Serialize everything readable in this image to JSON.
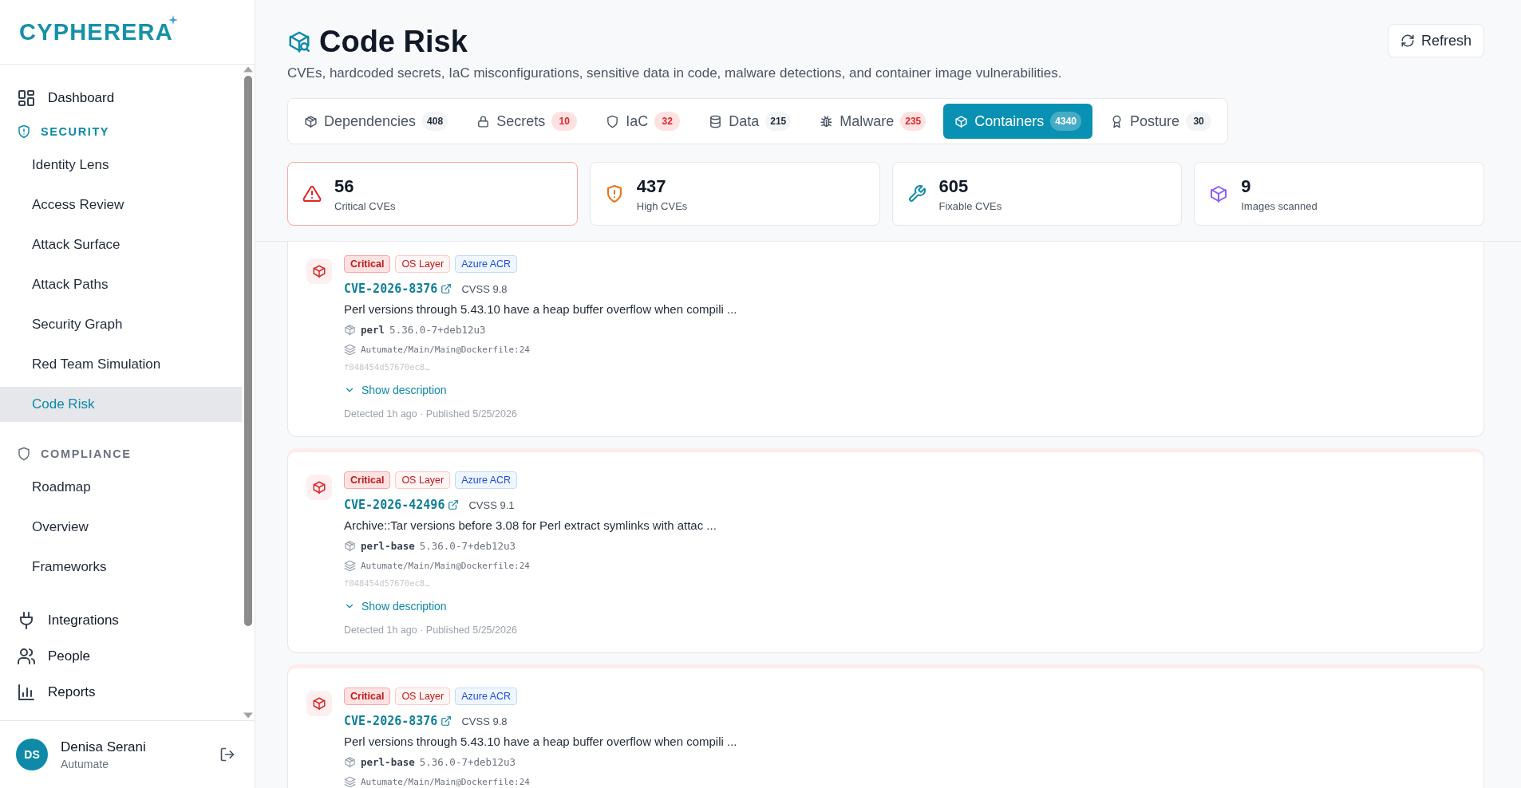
{
  "sidebar": {
    "logo": "CYPHERERA",
    "nav": [
      {
        "kind": "link",
        "label": "Dashboard",
        "selected": false
      },
      {
        "kind": "section",
        "label": "SECURITY",
        "children": [
          {
            "label": "Identity Lens",
            "selected": false
          },
          {
            "label": "Access Review",
            "selected": false
          },
          {
            "label": "Attack Surface",
            "selected": false
          },
          {
            "label": "Attack Paths",
            "selected": false
          },
          {
            "label": "Security Graph",
            "selected": false
          },
          {
            "label": "Red Team Simulation",
            "selected": false
          },
          {
            "label": "Code Risk",
            "selected": true
          }
        ]
      },
      {
        "kind": "section",
        "label": "COMPLIANCE",
        "children": [
          {
            "label": "Roadmap",
            "selected": false
          },
          {
            "label": "Overview",
            "selected": false
          },
          {
            "label": "Frameworks",
            "selected": false
          }
        ]
      },
      {
        "kind": "link",
        "label": "Integrations",
        "selected": false
      },
      {
        "kind": "link",
        "label": "People",
        "selected": false
      },
      {
        "kind": "link",
        "label": "Reports",
        "selected": false
      }
    ],
    "user": {
      "initials": "DS",
      "name": "Denisa Serani",
      "org": "Autumate"
    }
  },
  "header": {
    "title": "Code Risk",
    "subtitle": "CVEs, hardcoded secrets, IaC misconfigurations, sensitive data in code, malware detections, and container image vulnerabilities.",
    "refresh": "Refresh"
  },
  "tabs": [
    {
      "label": "Dependencies",
      "count": "408",
      "alert": false,
      "selected": false
    },
    {
      "label": "Secrets",
      "count": "10",
      "alert": true,
      "selected": false
    },
    {
      "label": "IaC",
      "count": "32",
      "alert": true,
      "selected": false
    },
    {
      "label": "Data",
      "count": "215",
      "alert": false,
      "selected": false
    },
    {
      "label": "Malware",
      "count": "235",
      "alert": true,
      "selected": false
    },
    {
      "label": "Containers",
      "count": "4340",
      "alert": false,
      "selected": true
    },
    {
      "label": "Posture",
      "count": "30",
      "alert": false,
      "selected": false
    }
  ],
  "stats": [
    {
      "kind": "critical",
      "value": "56",
      "label": "Critical CVEs"
    },
    {
      "kind": "high",
      "value": "437",
      "label": "High CVEs"
    },
    {
      "kind": "fixable",
      "value": "605",
      "label": "Fixable CVEs"
    },
    {
      "kind": "images",
      "value": "9",
      "label": "Images scanned"
    }
  ],
  "findings": [
    {
      "tags": [
        {
          "kind": "severity",
          "text": "Critical"
        },
        {
          "kind": "layer",
          "text": "OS Layer"
        },
        {
          "kind": "registry",
          "text": "Azure ACR"
        }
      ],
      "cve": "CVE-2026-8376",
      "cvss": "CVSS 9.8",
      "description": "Perl versions through 5.43.10 have a heap buffer overflow when compili ...",
      "package": "perl",
      "version": "5.36.0-7+deb12u3",
      "path": "Autumate/Main/Main@Dockerfile:24",
      "hash": "f048454d57670ec8…",
      "toggle": "Show description",
      "expanded": false,
      "meta": "Detected 1h ago · Published 5/25/2026"
    },
    {
      "tags": [
        {
          "kind": "severity",
          "text": "Critical"
        },
        {
          "kind": "layer",
          "text": "OS Layer"
        },
        {
          "kind": "registry",
          "text": "Azure ACR"
        }
      ],
      "cve": "CVE-2026-42496",
      "cvss": "CVSS 9.1",
      "description": "Archive::Tar versions before 3.08 for Perl extract symlinks with attac ...",
      "package": "perl-base",
      "version": "5.36.0-7+deb12u3",
      "path": "Autumate/Main/Main@Dockerfile:24",
      "hash": "f048454d57670ec8…",
      "toggle": "Show description",
      "expanded": false,
      "meta": "Detected 1h ago · Published 5/25/2026"
    },
    {
      "tags": [
        {
          "kind": "severity",
          "text": "Critical"
        },
        {
          "kind": "layer",
          "text": "OS Layer"
        },
        {
          "kind": "registry",
          "text": "Azure ACR"
        }
      ],
      "cve": "CVE-2026-8376",
      "cvss": "CVSS 9.8",
      "description": "Perl versions through 5.43.10 have a heap buffer overflow when compili ...",
      "package": "perl-base",
      "version": "5.36.0-7+deb12u3",
      "path": "Autumate/Main/Main@Dockerfile:24"
    }
  ]
}
